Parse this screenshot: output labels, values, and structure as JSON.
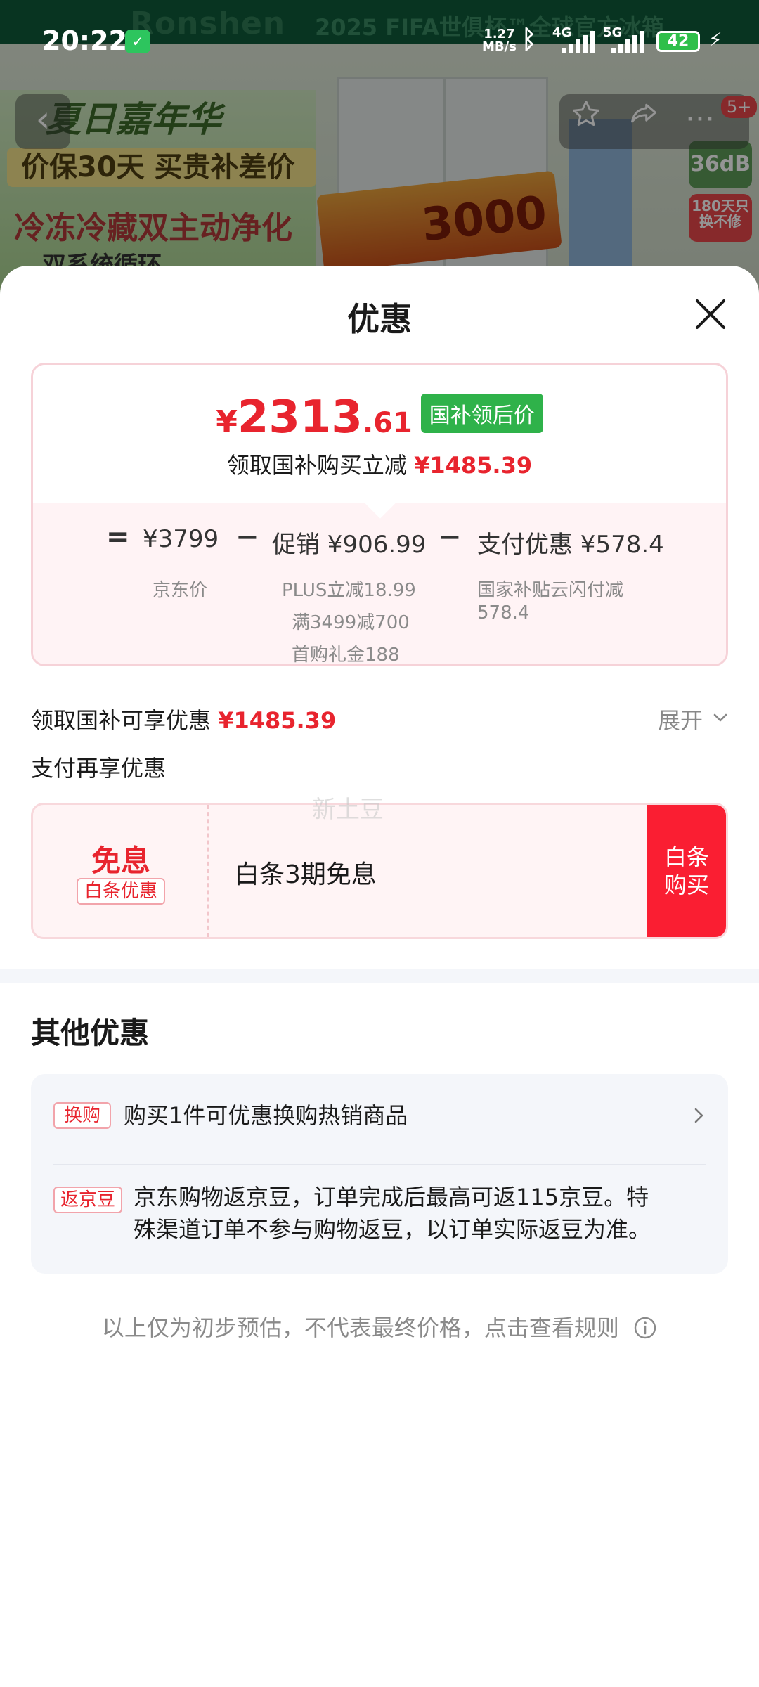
{
  "status_bar": {
    "time": "20:22",
    "net_speed_value": "1.27",
    "net_speed_unit": "MB/s",
    "network_4g": "4G",
    "network_5g": "5G",
    "battery": "42"
  },
  "background": {
    "brand": "Ronshen",
    "banner_text": "2025 FIFA世俱杯™全球官方冰箱",
    "ad_line1": "夏日嘉年华",
    "ad_line2": "价保30天 买贵补差价",
    "ad_line3": "冷冻冷藏双主动净化",
    "ad_line4": "双系统循环",
    "promo_amount": "3000",
    "badge_noise": "36dB",
    "badge_warranty": "180天只换不修",
    "cart_badge": "5+"
  },
  "sheet": {
    "title": "优惠",
    "price": {
      "currency": "¥",
      "integer": "2313",
      "decimal": ".61",
      "tag": "国补领后价",
      "subtitle_prefix": "领取国补购买立减",
      "subtitle_amount": "¥1485.39"
    },
    "breakdown": {
      "equals": "=",
      "minus": "−",
      "jd_price": "¥3799",
      "jd_price_label": "京东价",
      "promo": "促销 ¥906.99",
      "promo_notes": [
        "PLUS立减18.99",
        "满3499减700",
        "首购礼金188"
      ],
      "pay_discount": "支付优惠 ¥578.4",
      "pay_notes": [
        "国家补贴云闪付减",
        "578.4"
      ]
    },
    "subsidy_row": {
      "label": "领取国补可享优惠",
      "amount": "¥1485.39",
      "expand": "展开"
    },
    "pay_again_label": "支付再享优惠",
    "installment": {
      "title": "免息",
      "badge": "白条优惠",
      "text": "白条3期免息",
      "button_line1": "白条",
      "button_line2": "购买"
    },
    "watermark": "新土豆",
    "other": {
      "title": "其他优惠",
      "items": [
        {
          "tag": "换购",
          "text": "购买1件可优惠换购热销商品"
        },
        {
          "tag": "返京豆",
          "text_line1": "京东购物返京豆，订单完成后最高可返115京豆。特",
          "text_line2": "殊渠道订单不参与购物返豆，以订单实际返豆为准。"
        }
      ]
    },
    "footer_note": "以上仅为初步预估，不代表最终价格，点击查看规则"
  },
  "colors": {
    "accent_red": "#e8242e",
    "button_red": "#fa1e32",
    "tag_green": "#2fb24a"
  }
}
